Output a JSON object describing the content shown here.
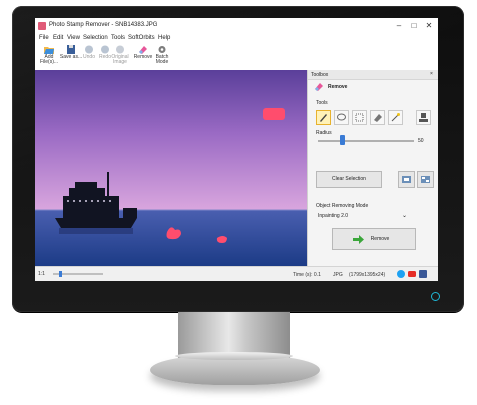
{
  "window": {
    "title": "Photo Stamp Remover - SNB14383.JPG",
    "controls": [
      "–",
      "□",
      "✕"
    ]
  },
  "menu": [
    "File",
    "Edit",
    "View",
    "Selection",
    "Tools",
    "SoftOrbits",
    "Help"
  ],
  "toolbar": {
    "add_files": "Add File(s)...",
    "save_as": "Save as...",
    "undo": "Undo",
    "redo": "Redo",
    "original_image": "Original Image",
    "remove": "Remove",
    "batch_mode": "Batch Mode"
  },
  "toolbox": {
    "title": "Toolbox",
    "close": "×",
    "tab_remove": "Remove",
    "tools_label": "Tools",
    "radius_label": "Radius",
    "radius_value": "50",
    "radius_fraction": 0.25,
    "clear_selection": "Clear Selection",
    "mode_label": "Object Removing Mode",
    "mode_value": "Inpainting 2.0",
    "remove_button": "Remove"
  },
  "statusbar": {
    "zoom_value": "1:1",
    "time": "Time (s): 0.1",
    "format": "JPG",
    "dimensions": "(1799x1395x24)"
  },
  "colors": {
    "accent": "#3a7bd5",
    "mask": "#ff4d6d",
    "sky_top": "#5a3f9a",
    "sky_bottom": "#c58fd6",
    "sea": "#2c4f9c"
  }
}
